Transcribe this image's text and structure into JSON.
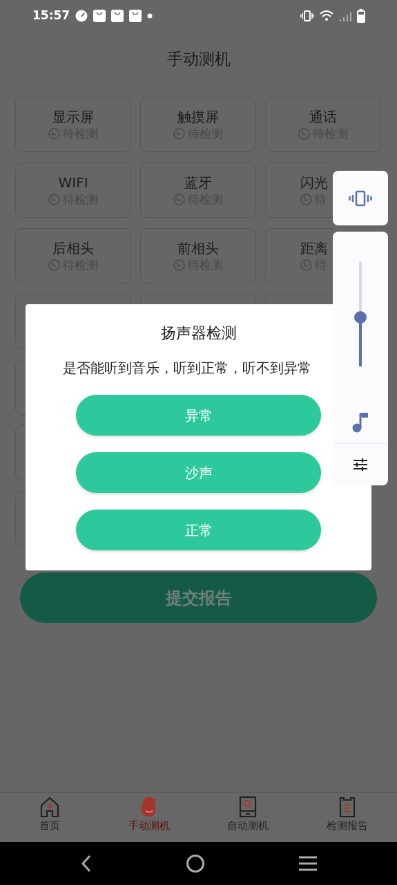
{
  "status_bar": {
    "time": "15:57"
  },
  "header": {
    "title": "手动测机"
  },
  "test_items": [
    {
      "name": "显示屏",
      "status": "待检测"
    },
    {
      "name": "触摸屏",
      "status": "待检测"
    },
    {
      "name": "通话",
      "status": "待检测"
    },
    {
      "name": "WIFI",
      "status": "待检测"
    },
    {
      "name": "蓝牙",
      "status": "待检测"
    },
    {
      "name": "闪光",
      "status": "待"
    },
    {
      "name": "后相头",
      "status": "待检测"
    },
    {
      "name": "前相头",
      "status": "待检测"
    },
    {
      "name": "距离",
      "status": "待"
    }
  ],
  "submit_button": "提交报告",
  "dialog": {
    "title": "扬声器检测",
    "message": "是否能听到音乐，听到正常，听不到异常",
    "buttons": [
      "异常",
      "沙声",
      "正常"
    ]
  },
  "volume_panel": {
    "level": 0.47
  },
  "bottom_nav": [
    {
      "label": "首页",
      "selected": false
    },
    {
      "label": "手动测机",
      "selected": true
    },
    {
      "label": "自动测机",
      "selected": false
    },
    {
      "label": "检测报告",
      "selected": false
    }
  ]
}
